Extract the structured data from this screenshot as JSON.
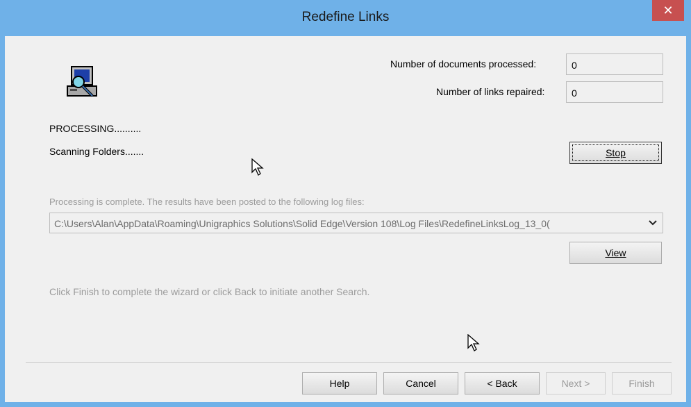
{
  "window": {
    "title": "Redefine Links",
    "close_glyph": "✕"
  },
  "icon": {
    "name": "computer-search-icon"
  },
  "stats": {
    "docs_label": "Number of documents  processed:",
    "docs_value": "0",
    "links_label": "Number of links repaired:",
    "links_value": "0"
  },
  "status": {
    "processing": "PROCESSING..........",
    "scanning": "Scanning Folders......."
  },
  "buttons": {
    "stop": "Stop",
    "view": "View",
    "help": "Help",
    "cancel": "Cancel",
    "back": "< Back",
    "next": "Next >",
    "finish": "Finish"
  },
  "log": {
    "caption": "Processing is complete.  The results have been posted to the following log files:",
    "path": "C:\\Users\\Alan\\AppData\\Roaming\\Unigraphics Solutions\\Solid Edge\\Version 108\\Log Files\\RedefineLinksLog_13_0("
  },
  "instructions": "Click Finish to complete the wizard or click Back to initiate another Search.",
  "colors": {
    "titlebar": "#6fb1e8",
    "close": "#c75050",
    "disabled_text": "#9b9b9b"
  }
}
